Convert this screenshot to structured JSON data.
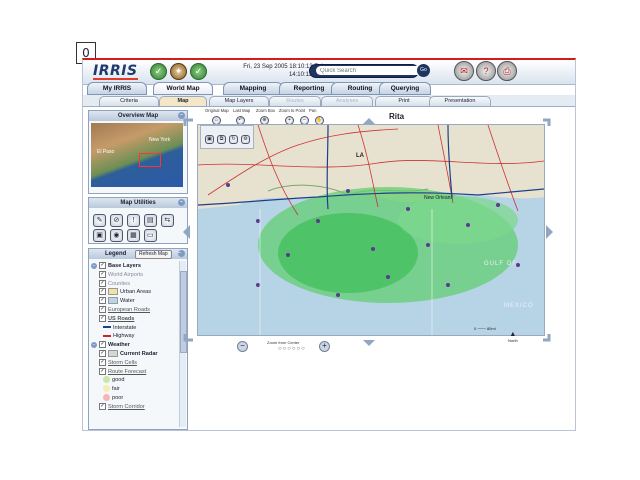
{
  "frame_label": "0",
  "app": {
    "logo": "IRRIS"
  },
  "datetime": {
    "zulu": "Fri, 23 Sep 2005 18:10:13 Zulu",
    "edt": "14:10:13 EDT"
  },
  "search": {
    "placeholder": "Quick Search",
    "go_label": "Go"
  },
  "main_nav": [
    "My IRRIS",
    "World Map",
    "Mapping",
    "Reporting",
    "Routing",
    "Querying"
  ],
  "sub_tabs": [
    "Criteria",
    "Map",
    "Map Layers",
    "Routes",
    "Analyses",
    "Print",
    "Presentation"
  ],
  "map_tools": {
    "labels": [
      "Original Map",
      "Last Map",
      "Zoom Box",
      "Zoom to Point",
      "Pan"
    ],
    "map_title": "Rita",
    "zoom_label": "Zoom from Center",
    "scale_label": "0 ─── 80mi",
    "north_label": "North"
  },
  "overview": {
    "title": "Overview Map",
    "labels": [
      "New York",
      "El Paso"
    ]
  },
  "utilities": {
    "title": "Map Utilities"
  },
  "legend": {
    "title": "Legend",
    "refresh": "Refresh Map",
    "items": [
      {
        "label": "Base Layers",
        "kind": "group"
      },
      {
        "label": "World Airports",
        "kind": "muted"
      },
      {
        "label": "Counties",
        "kind": "muted"
      },
      {
        "label": "Urban Areas",
        "kind": "swatch",
        "color": "#f0e2a0"
      },
      {
        "label": "Water",
        "kind": "swatch",
        "color": "#bcd4ea"
      },
      {
        "label": "European Roads",
        "kind": "link"
      },
      {
        "label": "US Roads",
        "kind": "bold-link"
      },
      {
        "label": "Interstate",
        "kind": "line",
        "color": "#1f3f88"
      },
      {
        "label": "Highway",
        "kind": "line",
        "color": "#c22"
      },
      {
        "label": "Weather",
        "kind": "group"
      },
      {
        "label": "Current Radar",
        "kind": "bold-swatch",
        "color": "#d6d6d6"
      },
      {
        "label": "Storm Cells",
        "kind": "link"
      },
      {
        "label": "Route Forecast",
        "kind": "link"
      },
      {
        "label": "good",
        "kind": "dot",
        "color": "#c9e8a6"
      },
      {
        "label": "fair",
        "kind": "dot",
        "color": "#f5ecb0"
      },
      {
        "label": "poor",
        "kind": "dot",
        "color": "#f2b6b6"
      },
      {
        "label": "Storm Corridor",
        "kind": "link"
      }
    ]
  },
  "map_labels": [
    "LA",
    "New Orleans",
    "GULF OF",
    "MEXICO"
  ]
}
